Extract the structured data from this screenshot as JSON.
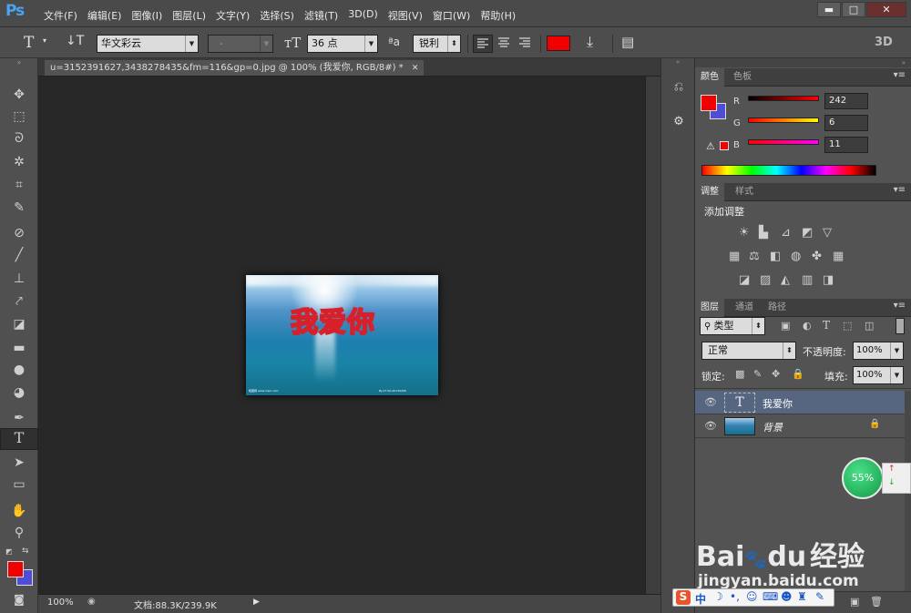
{
  "app_logo": "Ps",
  "menu": [
    "文件(F)",
    "编辑(E)",
    "图像(I)",
    "图层(L)",
    "文字(Y)",
    "选择(S)",
    "滤镜(T)",
    "3D(D)",
    "视图(V)",
    "窗口(W)",
    "帮助(H)"
  ],
  "window": {
    "minimize": "▬",
    "maximize": "□",
    "close": "✕"
  },
  "options": {
    "font_family": "华文彩云",
    "font_style": "-",
    "font_size": "36 点",
    "aa_icon": "ªa",
    "anti_alias": "锐利",
    "text_color": "#f20000",
    "mode_3d": "3D"
  },
  "document": {
    "tab_title": "u=3152391627,3438278435&fm=116&gp=0.jpg @ 100% (我爱你, RGB/8#) *",
    "close": "✕",
    "canvas_text": "我爱你",
    "watermark_left": "昵图网 www.nipic.com",
    "watermark_right": "By:17 No:20130406"
  },
  "status": {
    "zoom": "100%",
    "doc_size": "文档:88.3K/239.9K"
  },
  "colors": {
    "foreground": "#f20000",
    "background": "#4d4dd6"
  },
  "color_panel": {
    "tabs": [
      "颜色",
      "色板"
    ],
    "channels": [
      {
        "label": "R",
        "value": "242"
      },
      {
        "label": "G",
        "value": "6"
      },
      {
        "label": "B",
        "value": "11"
      }
    ]
  },
  "adjust_panel": {
    "tabs": [
      "调整",
      "样式"
    ],
    "heading": "添加调整"
  },
  "layers_panel": {
    "tabs": [
      "图层",
      "通道",
      "路径"
    ],
    "filter": "类型",
    "blend_mode": "正常",
    "opacity_label": "不透明度:",
    "opacity": "100%",
    "lock_label": "锁定:",
    "fill_label": "填充:",
    "fill": "100%",
    "layers": [
      {
        "name": "我爱你",
        "type": "T"
      },
      {
        "name": "背景"
      }
    ]
  },
  "badge": {
    "percent": "55%"
  },
  "baidu": {
    "logo_bai": "Bai",
    "logo_du": "du",
    "logo_jy": "经验",
    "url": "jingyan.baidu.com",
    "ime": "中"
  }
}
